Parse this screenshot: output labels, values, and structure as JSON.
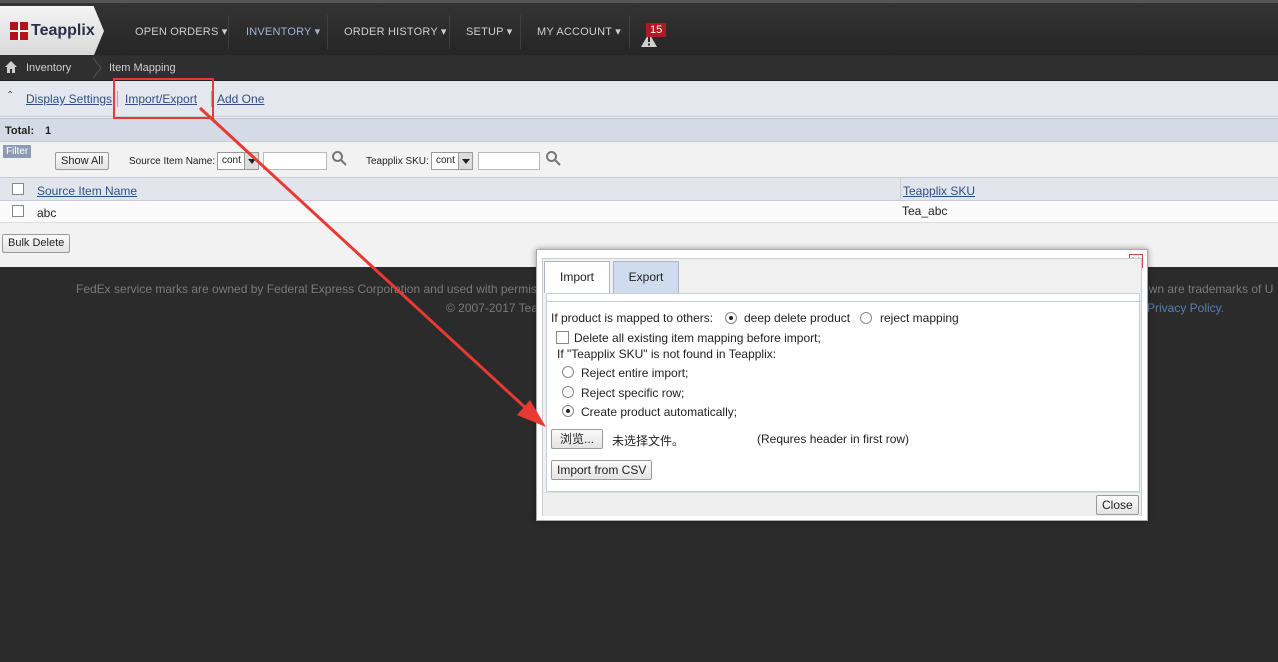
{
  "brand": {
    "name": "Teapplix"
  },
  "nav": {
    "items": [
      {
        "label": "OPEN ORDERS ▾"
      },
      {
        "label": "INVENTORY ▾"
      },
      {
        "label": "ORDER HISTORY ▾"
      },
      {
        "label": "SETUP ▾"
      },
      {
        "label": "MY ACCOUNT ▾"
      }
    ],
    "alert_count": "15"
  },
  "breadcrumb": {
    "items": [
      "Inventory",
      "Item Mapping"
    ]
  },
  "toolbar": {
    "collapse": "⌃",
    "display_settings": "Display Settings",
    "import_export": "Import/Export",
    "add_one": "Add One"
  },
  "summary": {
    "total_label": "Total:",
    "total_value": "1"
  },
  "filter": {
    "tag": "Filter",
    "show_all": "Show All",
    "source_item_name_label": "Source Item Name:",
    "source_item_name_op": "cont",
    "teapplix_sku_label": "Teapplix SKU:",
    "teapplix_sku_op": "cont"
  },
  "table": {
    "columns": [
      "Source Item Name",
      "Teapplix SKU"
    ],
    "rows": [
      {
        "source_item_name": "abc",
        "teapplix_sku": "Tea_abc"
      }
    ]
  },
  "bulk_delete": "Bulk Delete",
  "footer": {
    "line1": "FedEx service marks are owned by Federal Express Corporation and used with permission.",
    "line1_right": "own are trademarks of U",
    "line2": "© 2007-2017 Tea",
    "privacy": "Privacy Policy."
  },
  "modal": {
    "tabs": [
      "Import",
      "Export"
    ],
    "mapped_question": "If product is mapped to others:",
    "opt_deep_delete": "deep delete product",
    "opt_reject_mapping": "reject mapping",
    "delete_all_label": "Delete all existing item mapping before import;",
    "sku_not_found": "If \"Teapplix SKU\" is not found in Teapplix:",
    "opt_reject_entire": "Reject entire import;",
    "opt_reject_row": "Reject specific row;",
    "opt_create_auto": "Create product automatically;",
    "browse_button": "浏览...",
    "no_file": "未选择文件。",
    "header_note": "(Requres header in first row)",
    "import_csv": "Import from CSV",
    "close": "Close"
  },
  "colors": {
    "annotation_red": "#e63a32",
    "link_blue": "#2f4f86",
    "nav_bg": "#2b2b2b",
    "alert_red": "#b01a20"
  }
}
